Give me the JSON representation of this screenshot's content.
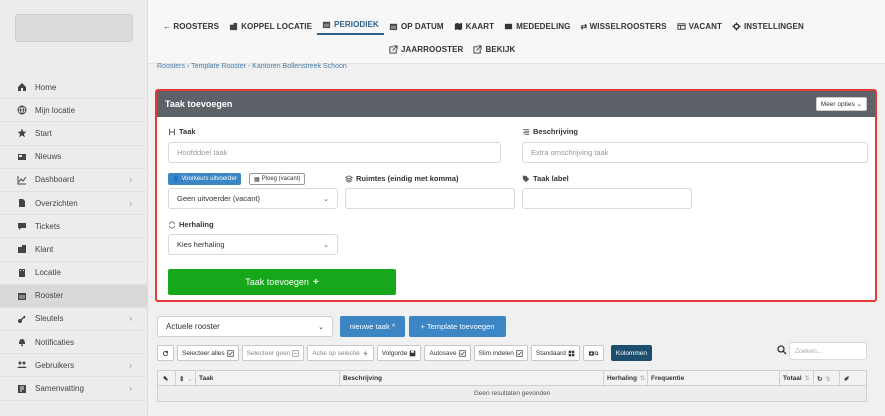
{
  "sidebar": {
    "items": [
      {
        "label": "Home",
        "icon": "home-icon",
        "chevron": false
      },
      {
        "label": "Mijn locatie",
        "icon": "globe-icon",
        "chevron": false
      },
      {
        "label": "Start",
        "icon": "star-icon",
        "chevron": false
      },
      {
        "label": "Nieuws",
        "icon": "newspaper-icon",
        "chevron": false
      },
      {
        "label": "Dashboard",
        "icon": "chart-icon",
        "chevron": true
      },
      {
        "label": "Overzichten",
        "icon": "document-icon",
        "chevron": true
      },
      {
        "label": "Tickets",
        "icon": "comment-icon",
        "chevron": false
      },
      {
        "label": "Klant",
        "icon": "building-icon",
        "chevron": false
      },
      {
        "label": "Locatie",
        "icon": "location-building-icon",
        "chevron": false
      },
      {
        "label": "Rooster",
        "icon": "calendar-icon",
        "chevron": false,
        "active": true
      },
      {
        "label": "Sleutels",
        "icon": "key-icon",
        "chevron": true
      },
      {
        "label": "Notificaties",
        "icon": "bell-icon",
        "chevron": false
      },
      {
        "label": "Gebruikers",
        "icon": "users-icon",
        "chevron": true
      },
      {
        "label": "Samenvatting",
        "icon": "summary-icon",
        "chevron": true
      }
    ]
  },
  "topnav": {
    "row1": [
      {
        "label": "← ROOSTERS",
        "icon": ""
      },
      {
        "label": "KOPPEL LOCATIE",
        "icon": "building-icon"
      },
      {
        "label": "PERIODIEK",
        "icon": "calendar-icon",
        "active": true
      },
      {
        "label": "OP DATUM",
        "icon": "calendar-icon"
      },
      {
        "label": "KAART",
        "icon": "map-icon"
      },
      {
        "label": "MEDEDELING",
        "icon": "message-icon"
      },
      {
        "label": "⇄ WISSELROOSTERS",
        "icon": ""
      },
      {
        "label": "VACANT",
        "icon": "vacant-icon"
      },
      {
        "label": "INSTELLINGEN",
        "icon": "gear-icon"
      }
    ],
    "row2": [
      {
        "label": "JAARROOSTER",
        "icon": "external-icon"
      },
      {
        "label": "BEKIJK",
        "icon": "external-icon"
      }
    ]
  },
  "breadcrumb": "Roosters  ›  Template Rooster - Kantoren Bollenstreek Schoon",
  "card": {
    "title": "Taak toevoegen",
    "meer_opties": "Meer opties ⌄",
    "taak_label": "Taak",
    "taak_placeholder": "Hoofddoel taak",
    "beschrijving_label": "Beschrijving",
    "beschrijving_placeholder": "Extra omschrijving taak",
    "voorkeurs_btn": "Voorkeurs uitvoerder",
    "ploeg_btn": "Ploeg (vacant)",
    "uitvoerder_value": "Geen uitvoerder (vacant)",
    "ruimtes_label": "Ruimtes (eindig met komma)",
    "taaklabel_label": "Taak label",
    "herhaling_label": "Herhaling",
    "herhaling_value": "Kies herhaling",
    "add_button": "Taak toevoegen",
    "add_plus": "+"
  },
  "bottom": {
    "rooster_select": "Actuele rooster",
    "nieuwe_taak": "nieuwe taak ^",
    "template_btn": "+ Template toevoegen",
    "toolbar": [
      {
        "label": "",
        "icon": "refresh-icon",
        "style": ""
      },
      {
        "label": "Selecteer alles",
        "icon": "checkbox-icon",
        "style": ""
      },
      {
        "label": "Selecteer geen",
        "icon": "checkbox-empty-icon",
        "style": "muted"
      },
      {
        "label": "Actie op selectie",
        "icon": "bolt-icon",
        "style": "muted"
      },
      {
        "label": "Volgorde",
        "icon": "save-icon",
        "style": ""
      },
      {
        "label": "Autosave",
        "icon": "checkbox-icon",
        "style": ""
      },
      {
        "label": "Slim indelen",
        "icon": "checkbox-icon",
        "style": ""
      },
      {
        "label": "Standaard",
        "icon": "grid-icon",
        "style": ""
      },
      {
        "label": "",
        "icon": "camera-icon",
        "style": ""
      },
      {
        "label": "Kolommen",
        "icon": "",
        "style": "dark"
      }
    ],
    "search_placeholder": "Zoeken...",
    "columns": {
      "taak": "Taak",
      "beschrijving": "Beschrijving",
      "herhaling": "Herhaling",
      "frequentie": "Frequentie",
      "totaal": "Totaal"
    },
    "empty_text": "Geen resultaten gevonden"
  },
  "colors": {
    "accent": "#2c5f8a",
    "primary_btn": "#3d86c6",
    "success": "#16a81a",
    "highlight": "#e53935",
    "card_header": "#5d6168"
  }
}
